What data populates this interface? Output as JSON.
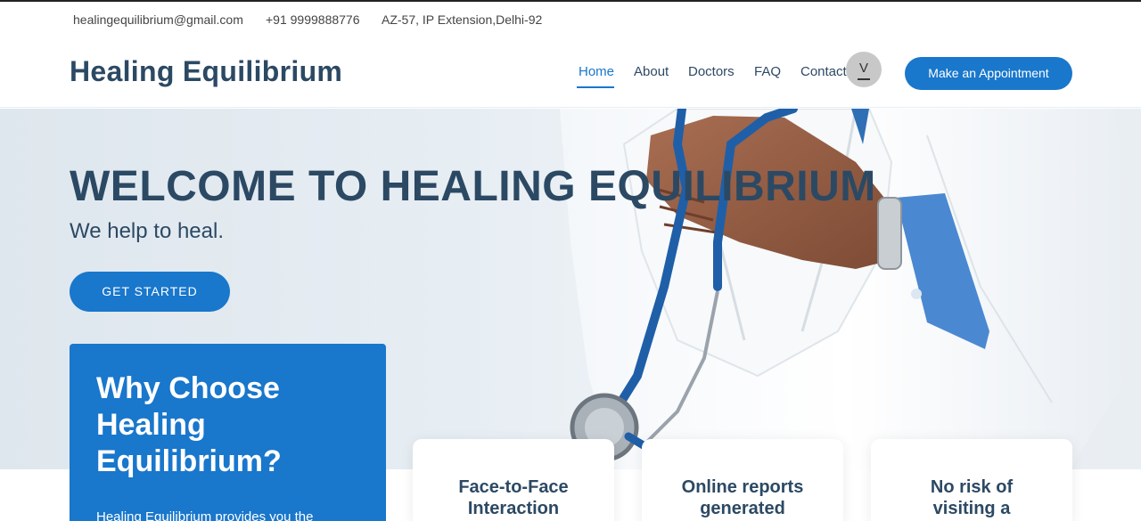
{
  "topbar": {
    "email": "healingequilibrium@gmail.com",
    "phone": "+91 9999888776",
    "address": "AZ-57, IP Extension,Delhi-92"
  },
  "header": {
    "logo": "Healing Equilibrium",
    "nav": {
      "home": "Home",
      "about": "About",
      "doctors": "Doctors",
      "faq": "FAQ",
      "contact": "Contact"
    },
    "avatar_letter": "V",
    "appointment_button": "Make an Appointment"
  },
  "hero": {
    "title": "WELCOME TO HEALING EQUILIBRIUM",
    "subtitle": "We help to heal.",
    "cta": "GET STARTED"
  },
  "why": {
    "title": "Why Choose Healing Equilibrium?",
    "text": "Healing Equilibrium provides you the"
  },
  "features": [
    {
      "line1": "Face-to-Face",
      "line2": "Interaction"
    },
    {
      "line1": "Online reports",
      "line2": "generated"
    },
    {
      "line1": "No risk of",
      "line2": "visiting a"
    }
  ],
  "colors": {
    "accent": "#1977cc",
    "heading": "#2c4964"
  }
}
